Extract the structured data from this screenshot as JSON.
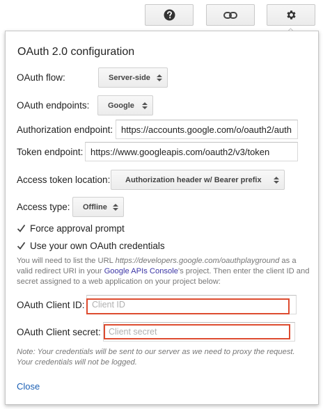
{
  "toolbar": {
    "help_icon": "question-circle",
    "link_icon": "chain-link",
    "settings_icon": "gear"
  },
  "panel": {
    "title": "OAuth 2.0 configuration",
    "flow": {
      "label": "OAuth flow:",
      "value": "Server-side"
    },
    "endpoints": {
      "label": "OAuth endpoints:",
      "value": "Google"
    },
    "auth_endpoint": {
      "label": "Authorization endpoint:",
      "value": "https://accounts.google.com/o/oauth2/auth"
    },
    "token_endpoint": {
      "label": "Token endpoint:",
      "value": "https://www.googleapis.com/oauth2/v3/token"
    },
    "token_location": {
      "label": "Access token location:",
      "value": "Authorization header w/ Bearer prefix"
    },
    "access_type": {
      "label": "Access type:",
      "value": "Offline"
    },
    "force_approval": {
      "label": "Force approval prompt",
      "checked": true
    },
    "own_credentials": {
      "label": "Use your own OAuth credentials",
      "checked": true
    },
    "info": {
      "part1": "You will need to list the URL ",
      "url": "https://developers.google.com/oauthplayground",
      "part2": " as a valid redirect URI in your ",
      "link": "Google APIs Console",
      "part3": "'s project. Then enter the client ID and secret assigned to a web application on your project below:"
    },
    "client_id": {
      "label": "OAuth Client ID:",
      "value": "",
      "placeholder": "Client ID"
    },
    "client_secret": {
      "label": "OAuth Client secret:",
      "value": "",
      "placeholder": "Client secret"
    },
    "note": "Note: Your credentials will be sent to our server as we need to proxy the request. Your credentials will not be logged.",
    "close_label": "Close"
  },
  "colors": {
    "highlight": "#dd4b2f",
    "link": "#3b35a6",
    "close": "#1a5fb4"
  }
}
